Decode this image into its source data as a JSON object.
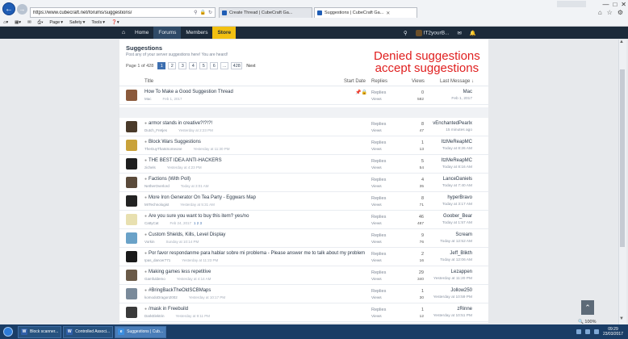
{
  "browser": {
    "url": "https://www.cubecraft.net/forums/suggestions/",
    "tabs": [
      {
        "label": "Create Thread | CubeCraft Ga...",
        "active": false
      },
      {
        "label": "Suggestions | CubeCraft Ga...",
        "active": true
      }
    ],
    "commands": [
      "Page",
      "Safety",
      "Tools"
    ],
    "window_controls": [
      "—",
      "□",
      "✕"
    ]
  },
  "site": {
    "nav": [
      {
        "label": "Home",
        "active": false
      },
      {
        "label": "Forums",
        "active": true
      },
      {
        "label": "Members",
        "active": false
      },
      {
        "label": "Store",
        "active": false
      }
    ],
    "username": "IT2yourB..."
  },
  "forum": {
    "title": "Suggestions",
    "subtitle": "Post any of your server suggestions here! You are heard!",
    "pager": {
      "label": "Page 1 of 428",
      "pages": [
        "1",
        "2",
        "3",
        "4",
        "5",
        "6"
      ],
      "last": "428",
      "dots": "...",
      "next": "Next"
    },
    "columns": {
      "title": "Title",
      "start_date": "Start Date",
      "replies": "Replies",
      "views": "Views",
      "last_message": "Last Message ↓"
    },
    "overlay_note": [
      "Denied suggestions",
      "accept suggestions"
    ],
    "sticky": {
      "title": "How To Make a Good Suggestion Thread",
      "author": "Mac",
      "date": "Feb 1, 2017",
      "replies": "0",
      "views": "582",
      "last_user": "Mac",
      "last_date": "Feb 1, 2017"
    },
    "threads": [
      {
        "title": "armor stands in creative?!?!?!",
        "author": "Dutch_Fretjes",
        "date": "Yesterday at 2:23 PM",
        "replies": "8",
        "views": "47",
        "last_user": "vEnchantedPearlx",
        "last_date": "15 minutes ago",
        "avatar": "#4a3a2a"
      },
      {
        "title": "Block Wars Suggestions",
        "author": "TheGuyThatsSomeone",
        "date": "Yesterday at 11:30 PM",
        "replies": "1",
        "views": "13",
        "last_user": "ItzMeReapMC",
        "last_date": "Today at 8:26 AM",
        "avatar": "#c9a23a"
      },
      {
        "title": "THE BEST IDEA ANTI-HACKERS",
        "author": "zichels",
        "date": "Yesterday at 4:23 PM",
        "replies": "5",
        "views": "54",
        "last_user": "ItzMeReapMC",
        "last_date": "Today at 8:16 AM",
        "avatar": "#1e1e1e"
      },
      {
        "title": "Factions (With Poll)",
        "author": "NetherOverlord",
        "date": "Today at 3:01 AM",
        "replies": "4",
        "views": "35",
        "last_user": "LanceDaniels",
        "last_date": "Today at 7:40 AM",
        "avatar": "#5a4a3a"
      },
      {
        "title": "More Iron Generator On Tea Party - Eggwars Map",
        "author": "MrTechnologist",
        "date": "Yesterday at 5:31 AM",
        "replies": "8",
        "views": "71",
        "last_user": "hyperBravo",
        "last_date": "Today at 3:17 AM",
        "avatar": "#222222"
      },
      {
        "title": "Are you sure you want to buy this item? yes/no",
        "author": "CattyCat",
        "date": "Feb 24, 2017",
        "replies": "46",
        "views": "487",
        "last_user": "Goober_Bear",
        "last_date": "Today at 1:57 AM",
        "avatar": "#e8e0b0",
        "pages": "1  2  3"
      },
      {
        "title": "Custom Shields, Kills, Level Display",
        "author": "Vorkin",
        "date": "Sunday at 10:14 PM",
        "replies": "9",
        "views": "76",
        "last_user": "Scream",
        "last_date": "Today at 12:52 AM",
        "avatar": "#6aa2c8"
      },
      {
        "title": "Por favor respondanme para hablar sobre mi problema - Please answer me to talk about my problem",
        "author": "Ipas_dancer771",
        "date": "Yesterday at 11:23 PM",
        "replies": "2",
        "views": "16",
        "last_user": "Jeff_Blikth",
        "last_date": "Today at 12:06 AM",
        "avatar": "#1a1a1a"
      },
      {
        "title": "Making games less repetitive",
        "author": "Gamfuldemo",
        "date": "Yesterday at 4:14 AM",
        "replies": "29",
        "views": "340",
        "last_user": "Lezappen",
        "last_date": "Yesterday at 11:20 PM",
        "avatar": "#6a5a48"
      },
      {
        "title": "#BringBackTheOldSCBMaps",
        "author": "komodoDragon2002",
        "date": "Yesterday at 10:17 PM",
        "replies": "1",
        "views": "30",
        "last_user": "Jollow250",
        "last_date": "Yesterday at 10:59 PM",
        "avatar": "#7a8a9a"
      },
      {
        "title": "/mask in Freebuild",
        "author": "DarkElektrin",
        "date": "Yesterday at 9:11 PM",
        "replies": "1",
        "views": "12",
        "last_user": "zRinne",
        "last_date": "Yesterday at 10:51 PM",
        "avatar": "#3a3a3a"
      }
    ]
  },
  "zoom": "100%",
  "taskbar": {
    "tasks": [
      {
        "label": "Block scanner...",
        "icon": "W"
      },
      {
        "label": "Controlled Associ...",
        "icon": "W"
      },
      {
        "label": "Suggestions | Cub...",
        "icon": "e"
      }
    ],
    "time": "09:29",
    "date": "23/03/2017"
  }
}
